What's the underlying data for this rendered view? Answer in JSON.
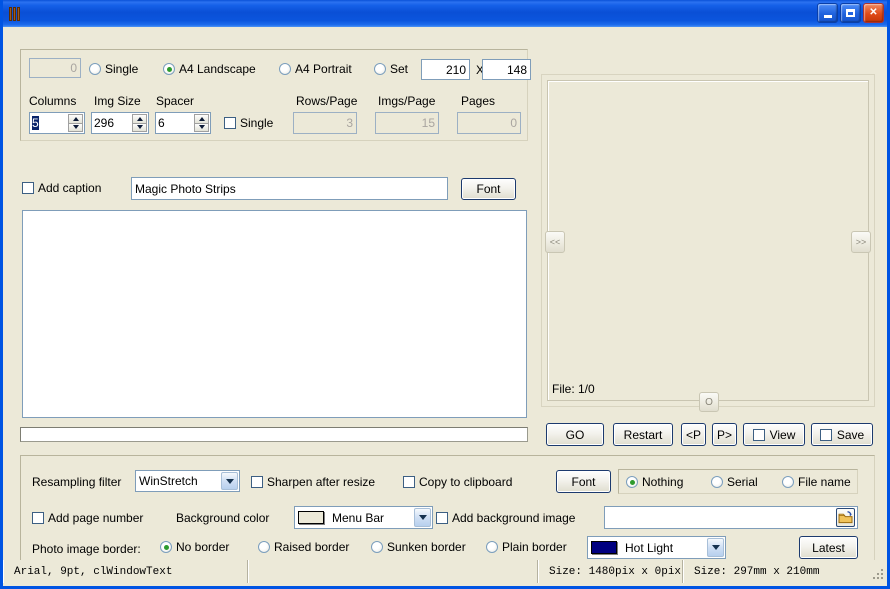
{
  "window": {
    "title": "",
    "icon": "book-icon",
    "minimize_label": "minimize",
    "maximize_label": "maximize",
    "close_label": "close"
  },
  "layout_panel": {
    "count_field": {
      "value": "0",
      "enabled": false
    },
    "page_size_options": [
      {
        "label": "Single",
        "selected": false
      },
      {
        "label": "A4 Landscape",
        "selected": true
      },
      {
        "label": "A4 Portrait",
        "selected": false
      },
      {
        "label": "Set",
        "selected": false
      }
    ],
    "set_width": "210",
    "set_x_label": "X",
    "set_height": "148",
    "columns_label": "Columns",
    "columns_value": "5",
    "img_size_label": "Img Size",
    "img_size_value": "296",
    "spacer_label": "Spacer",
    "spacer_value": "6",
    "single_checkbox": {
      "label": "Single",
      "checked": false
    },
    "rows_per_page_label": "Rows/Page",
    "rows_per_page_value": "3",
    "imgs_per_page_label": "Imgs/Page",
    "imgs_per_page_value": "15",
    "pages_label": "Pages",
    "pages_value": "0"
  },
  "caption_row": {
    "add_caption": {
      "label": "Add caption",
      "checked": false
    },
    "caption_text": "Magic Photo Strips",
    "caption_placeholder": "",
    "font_button": "Font"
  },
  "file_list": {
    "items": []
  },
  "progress": {
    "value": 0
  },
  "preview": {
    "prev_button": "<<",
    "next_button": ">>",
    "center_button": "O",
    "file_status": "File: 1/0"
  },
  "action_buttons": {
    "go": "GO",
    "restart": "Restart",
    "prev_page": "<P",
    "next_page": "P>",
    "view": {
      "label": "View",
      "checked": false
    },
    "save": {
      "label": "Save",
      "checked": false
    }
  },
  "settings": {
    "resampling_label": "Resampling filter",
    "resampling_value": "WinStretch",
    "sharpen": {
      "label": "Sharpen after resize",
      "checked": false
    },
    "copy_clipboard": {
      "label": "Copy to clipboard",
      "checked": false
    },
    "font_button": "Font",
    "caption_mode_options": [
      {
        "label": "Nothing",
        "selected": true
      },
      {
        "label": "Serial",
        "selected": false
      },
      {
        "label": "File name",
        "selected": false
      }
    ],
    "add_page_number": {
      "label": "Add page number",
      "checked": false
    },
    "background_color_label": "Background color",
    "background_color_value": "Menu Bar",
    "background_color_swatch": "#ece9d8",
    "add_background_image": {
      "label": "Add background image",
      "checked": false
    },
    "background_image_path": "",
    "background_image_placeholder": "",
    "browse_icon": "folder-open-icon",
    "border_label": "Photo image border:",
    "border_options": [
      {
        "label": "No border",
        "selected": true
      },
      {
        "label": "Raised border",
        "selected": false
      },
      {
        "label": "Sunken border",
        "selected": false
      },
      {
        "label": "Plain border",
        "selected": false
      }
    ],
    "border_color_value": "Hot Light",
    "border_color_swatch": "#000080",
    "latest_button": "Latest"
  },
  "statusbar": {
    "font_info": "Arial, 9pt, clWindowText",
    "blank_cell": "",
    "pixel_size": "Size: 1480pix x 0pix",
    "mm_size": "Size: 297mm x 210mm"
  }
}
